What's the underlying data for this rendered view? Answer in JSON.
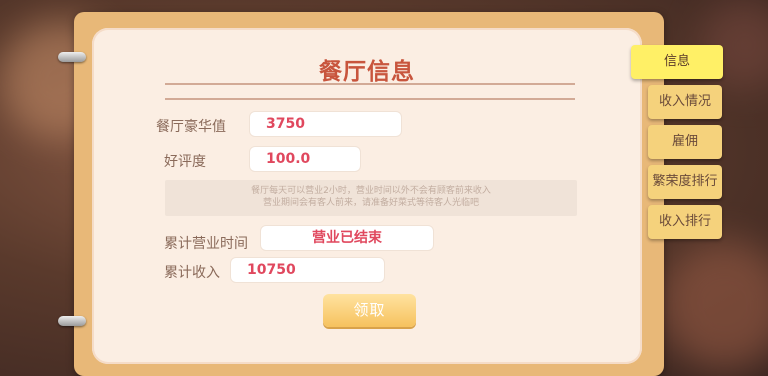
{
  "panel": {
    "title": "餐厅信息",
    "luxury_label": "餐厅豪华值",
    "luxury_value": "3750",
    "rating_label": "好评度",
    "rating_value": "100.0",
    "note_line1": "餐厅每天可以营业2小时，营业时间以外不会有顾客前来收入",
    "note_line2": "营业期间会有客人前来，请准备好菜式等待客人光临吧",
    "business_time_label": "累计营业时间",
    "business_time_value": "营业已结束",
    "income_label": "累计收入",
    "income_value": "10750",
    "claim_label": "领取"
  },
  "tabs": [
    {
      "label": "信息",
      "active": true
    },
    {
      "label": "收入情况",
      "active": false
    },
    {
      "label": "雇佣",
      "active": false
    },
    {
      "label": "繁荣度排行",
      "active": false
    },
    {
      "label": "收入排行",
      "active": false
    }
  ],
  "colors": {
    "title": "#c8553d",
    "value": "#e0485e",
    "tab": "#f5d27c",
    "tab_active": "#fff066",
    "button": "#f6c25e"
  }
}
